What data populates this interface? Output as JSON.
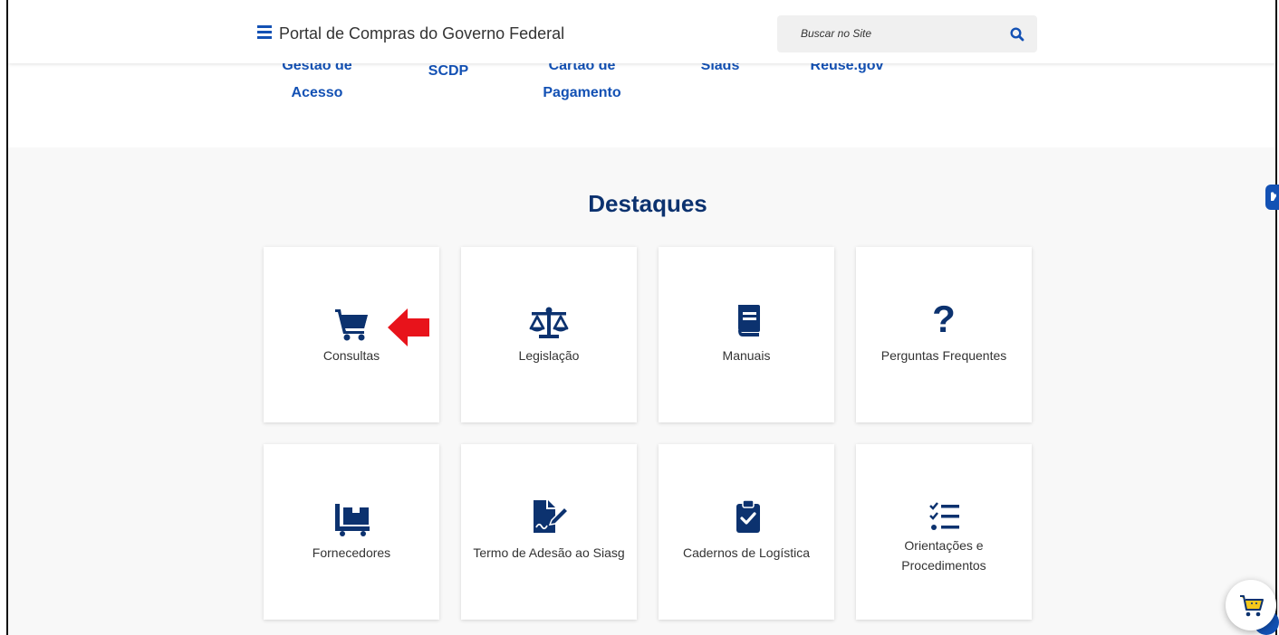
{
  "header": {
    "title": "Portal de Compras do Governo Federal",
    "search_placeholder": "Buscar no Site"
  },
  "top_links": [
    {
      "line1": "Gestão de",
      "line2": "Acesso"
    },
    {
      "line1": "SCDP",
      "line2": ""
    },
    {
      "line1": "Cartão de",
      "line2": "Pagamento"
    },
    {
      "line1": "Siads",
      "line2": ""
    },
    {
      "line1": "Reuse.gov",
      "line2": ""
    }
  ],
  "destaques": {
    "title": "Destaques",
    "cards": [
      {
        "label": "Consultas",
        "icon": "shopping-cart-icon"
      },
      {
        "label": "Legislação",
        "icon": "balance-scale-icon"
      },
      {
        "label": "Manuais",
        "icon": "book-icon"
      },
      {
        "label": "Perguntas Frequentes",
        "icon": "question-icon"
      },
      {
        "label": "Fornecedores",
        "icon": "dolly-icon"
      },
      {
        "label": "Termo de Adesão ao Siasg",
        "icon": "file-signature-icon"
      },
      {
        "label": "Cadernos de Logística",
        "icon": "clipboard-check-icon"
      },
      {
        "label": "Orientações e Procedimentos",
        "icon": "tasks-icon"
      }
    ]
  },
  "colors": {
    "primary_blue": "#1351b4",
    "dark_blue": "#0c326f",
    "arrow_red": "#e8131b",
    "cart_yellow": "#f3c71b"
  }
}
